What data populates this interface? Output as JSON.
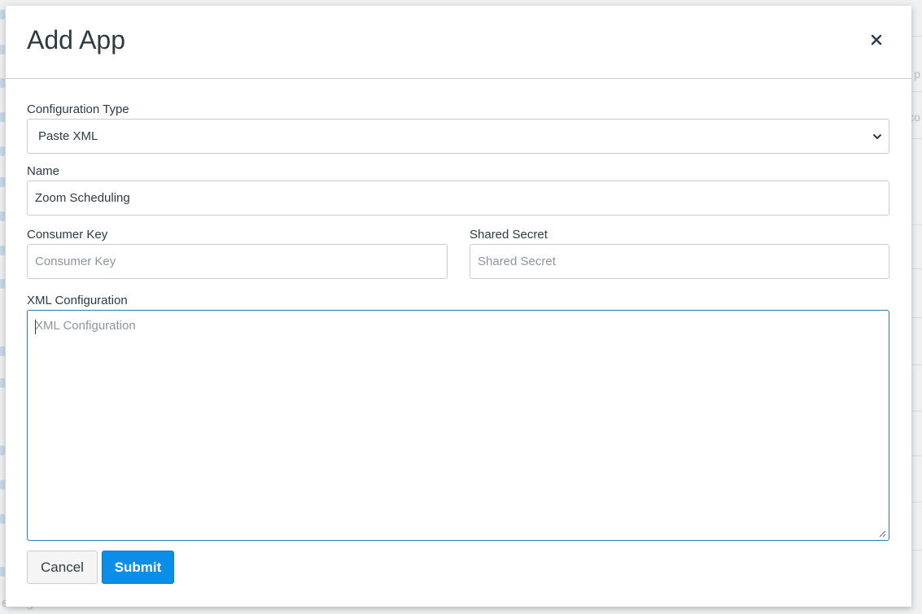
{
  "modal": {
    "title": "Add App",
    "close_label": "×"
  },
  "form": {
    "configuration_type": {
      "label": "Configuration Type",
      "selected": "Paste XML"
    },
    "name": {
      "label": "Name",
      "value": "Zoom Scheduling"
    },
    "consumer_key": {
      "label": "Consumer Key",
      "value": "",
      "placeholder": "Consumer Key"
    },
    "shared_secret": {
      "label": "Shared Secret",
      "value": "",
      "placeholder": "Shared Secret"
    },
    "xml_configuration": {
      "label": "XML Configuration",
      "value": "",
      "placeholder": "XML Configuration"
    }
  },
  "actions": {
    "cancel_label": "Cancel",
    "submit_label": "Submit"
  },
  "background": {
    "right_fragments": [
      "p",
      "co"
    ],
    "bottom_fragment": "ettings"
  },
  "colors": {
    "primary": "#0b8ee8",
    "text": "#2d3b45",
    "border": "#c7cdd1",
    "focus_border": "#2b7abc"
  },
  "icons": {
    "close": "close-icon",
    "select": "chevron-down-icon",
    "resize": "resize-handle-icon"
  }
}
